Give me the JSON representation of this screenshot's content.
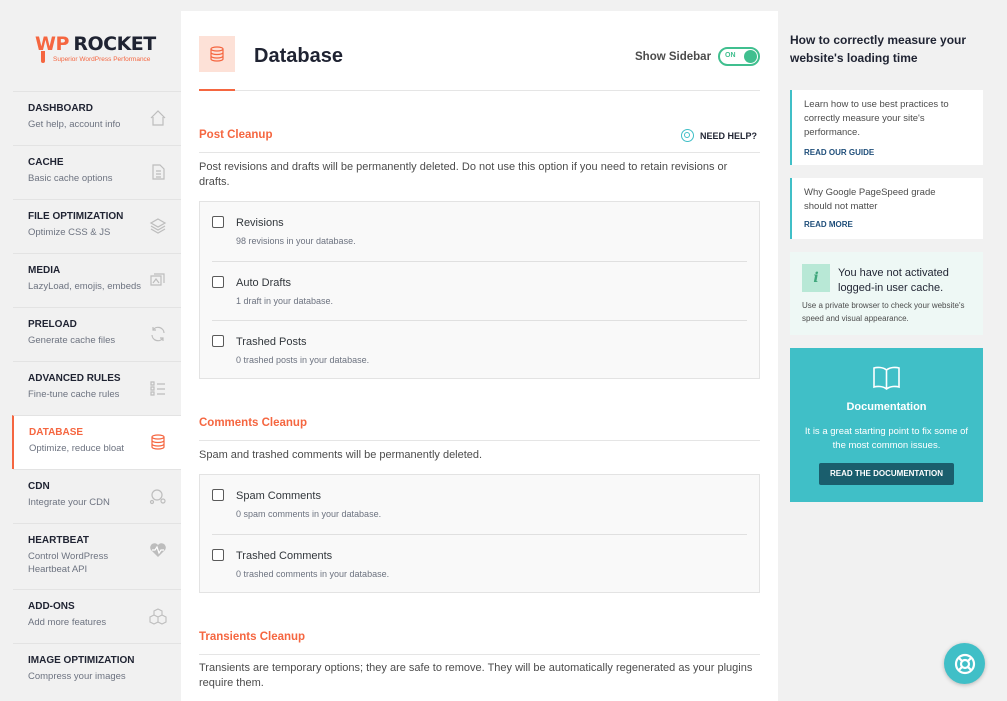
{
  "brand": {
    "name_wp": "WP",
    "name_rocket": "ROCKET",
    "tagline": "Superior WordPress Performance"
  },
  "nav": {
    "items": [
      {
        "title": "DASHBOARD",
        "subtitle": "Get help, account info",
        "icon": "home-icon"
      },
      {
        "title": "CACHE",
        "subtitle": "Basic cache options",
        "icon": "file-icon"
      },
      {
        "title": "FILE OPTIMIZATION",
        "subtitle": "Optimize CSS & JS",
        "icon": "layers-icon"
      },
      {
        "title": "MEDIA",
        "subtitle": "LazyLoad, emojis, embeds",
        "icon": "media-icon"
      },
      {
        "title": "PRELOAD",
        "subtitle": "Generate cache files",
        "icon": "refresh-icon"
      },
      {
        "title": "ADVANCED RULES",
        "subtitle": "Fine-tune cache rules",
        "icon": "list-icon"
      },
      {
        "title": "DATABASE",
        "subtitle": "Optimize, reduce bloat",
        "icon": "database-icon"
      },
      {
        "title": "CDN",
        "subtitle": "Integrate your CDN",
        "icon": "cdn-icon"
      },
      {
        "title": "HEARTBEAT",
        "subtitle": "Control WordPress Heartbeat API",
        "icon": "heartbeat-icon"
      },
      {
        "title": "ADD-ONS",
        "subtitle": "Add more features",
        "icon": "cubes-icon"
      },
      {
        "title": "IMAGE OPTIMIZATION",
        "subtitle": "Compress your images",
        "icon": "image-icon"
      }
    ],
    "active_index": 6
  },
  "header": {
    "title": "Database",
    "show_sidebar_label": "Show Sidebar",
    "toggle_label": "ON"
  },
  "post_cleanup": {
    "title": "Post Cleanup",
    "help_label": "NEED HELP?",
    "description": "Post revisions and drafts will be permanently deleted. Do not use this option if you need to retain revisions or drafts.",
    "options": [
      {
        "label": "Revisions",
        "detail": "98 revisions in your database."
      },
      {
        "label": "Auto Drafts",
        "detail": "1 draft in your database."
      },
      {
        "label": "Trashed Posts",
        "detail": "0 trashed posts in your database."
      }
    ]
  },
  "comments_cleanup": {
    "title": "Comments Cleanup",
    "description": "Spam and trashed comments will be permanently deleted.",
    "options": [
      {
        "label": "Spam Comments",
        "detail": "0 spam comments in your database."
      },
      {
        "label": "Trashed Comments",
        "detail": "0 trashed comments in your database."
      }
    ]
  },
  "transients_cleanup": {
    "title": "Transients Cleanup",
    "description": "Transients are temporary options; they are safe to remove. They will be automatically regenerated as your plugins require them."
  },
  "sidebar": {
    "title": "How to correctly measure your website's loading time",
    "cards": [
      {
        "text": "Learn how to use best practices to correctly measure your site's performance.",
        "link": "READ OUR GUIDE"
      },
      {
        "text": "Why Google PageSpeed grade should not matter",
        "link": "READ MORE"
      }
    ],
    "notice": {
      "badge": "i",
      "heading": "You have not activated logged-in user cache.",
      "text": "Use a private browser to check your website's speed and visual appearance."
    },
    "docs": {
      "title": "Documentation",
      "text": "It is a great starting point to fix some of the most common issues.",
      "button": "READ THE DOCUMENTATION"
    }
  },
  "colors": {
    "accent": "#f56640",
    "teal": "#40bfc7",
    "green": "#40bf8f",
    "dark_teal": "#1a5e6d"
  }
}
